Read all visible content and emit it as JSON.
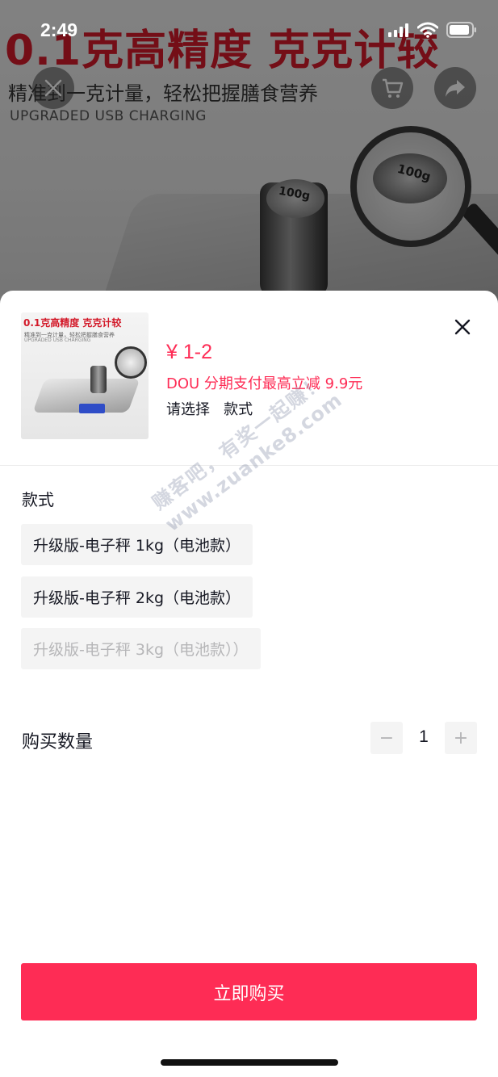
{
  "status_bar": {
    "time": "2:49"
  },
  "background": {
    "headline": "0.1克高精度 克克计较",
    "subline": "精准到一克计量，轻松把握膳食营养",
    "english": "UPGRADED USB CHARGING",
    "weight_label": "100g",
    "lens_label": "100g"
  },
  "product": {
    "thumb_title": "0.1克高精度 克克计较",
    "thumb_line1": "精准到一克计量，轻松把握膳食营养",
    "thumb_line2": "UPGRADED USB CHARGING",
    "price": "¥ 1-2",
    "promo": "DOU 分期支付最高立减 9.9元",
    "select_hint": "请选择",
    "select_hint_value": "款式"
  },
  "options_section": {
    "title": "款式",
    "options": [
      {
        "label": "升级版-电子秤 1kg（电池款）",
        "disabled": false
      },
      {
        "label": "升级版-电子秤 2kg（电池款）",
        "disabled": false
      },
      {
        "label": "升级版-电子秤 3kg（电池款））",
        "disabled": true
      }
    ]
  },
  "quantity": {
    "label": "购买数量",
    "value": "1",
    "minus": "−",
    "plus": "+"
  },
  "buy_button": {
    "label": "立即购买"
  },
  "watermark": {
    "line1": "赚客吧，有奖一起赚！",
    "line2": "www.zuanke8.com"
  },
  "icons": [
    "close-icon",
    "cart-icon",
    "share-icon",
    "signal-icon",
    "wifi-icon",
    "battery-icon"
  ],
  "colors": {
    "accent": "#fe2c55",
    "option_bg": "#f4f4f4",
    "disabled_text": "#b6b6b8"
  }
}
